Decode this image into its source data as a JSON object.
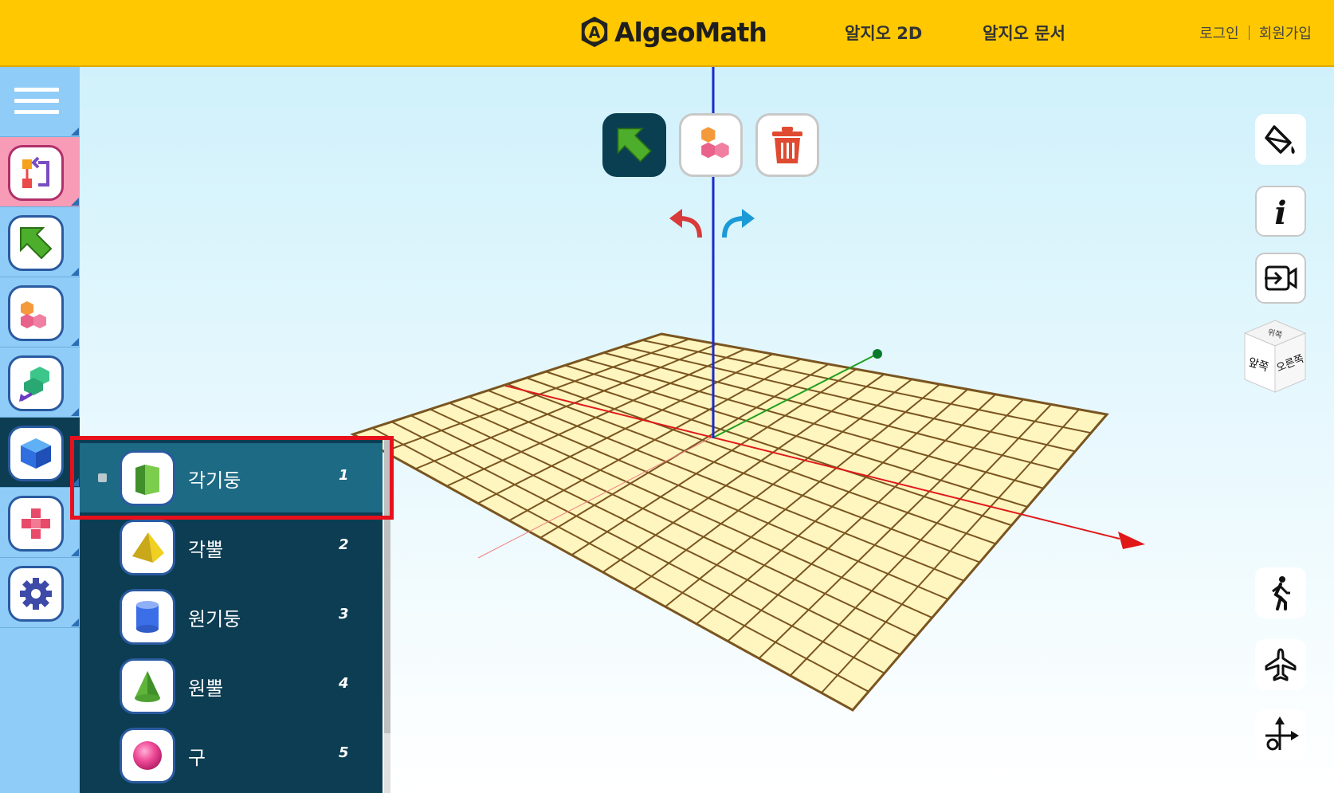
{
  "header": {
    "logo_text": "AlgeoMath",
    "nav": [
      "알지오 2D",
      "알지오 문서"
    ],
    "login": "로그인",
    "signup": "회원가입"
  },
  "sidebar": {
    "items": [
      {
        "name": "menu-icon"
      },
      {
        "name": "switch-mode-icon"
      },
      {
        "name": "select-arrow-icon"
      },
      {
        "name": "block-stack-icon"
      },
      {
        "name": "net-unfold-icon"
      },
      {
        "name": "cube-icon"
      },
      {
        "name": "cross-net-icon"
      },
      {
        "name": "gear-icon"
      }
    ]
  },
  "toolbar": {
    "tools": [
      "select-arrow-icon",
      "block-stack-icon",
      "trash-icon"
    ],
    "undo": "undo-icon",
    "redo": "redo-icon"
  },
  "right_panel": {
    "view_cube": {
      "top": "위쪽",
      "front": "앞쪽",
      "right": "오른쪽"
    },
    "buttons": [
      "paint-bucket-icon",
      "info-icon",
      "export-video-icon",
      "walk-icon",
      "airplane-icon",
      "axis-compass-icon"
    ]
  },
  "shape_menu": {
    "items": [
      {
        "label": "각기둥",
        "num": "1",
        "icon": "prism-icon",
        "selected": true
      },
      {
        "label": "각뿔",
        "num": "2",
        "icon": "pyramid-icon",
        "selected": false
      },
      {
        "label": "원기둥",
        "num": "3",
        "icon": "cylinder-icon",
        "selected": false
      },
      {
        "label": "원뿔",
        "num": "4",
        "icon": "cone-icon",
        "selected": false
      },
      {
        "label": "구",
        "num": "5",
        "icon": "sphere-icon",
        "selected": false
      }
    ]
  },
  "colors": {
    "header_bg": "#ffc800",
    "menu_bg": "#0c3d52",
    "menu_selected": "#1d6a84",
    "grid_fill": "#fff5bf",
    "grid_line": "#7a5520",
    "highlight": "#e8101c"
  }
}
